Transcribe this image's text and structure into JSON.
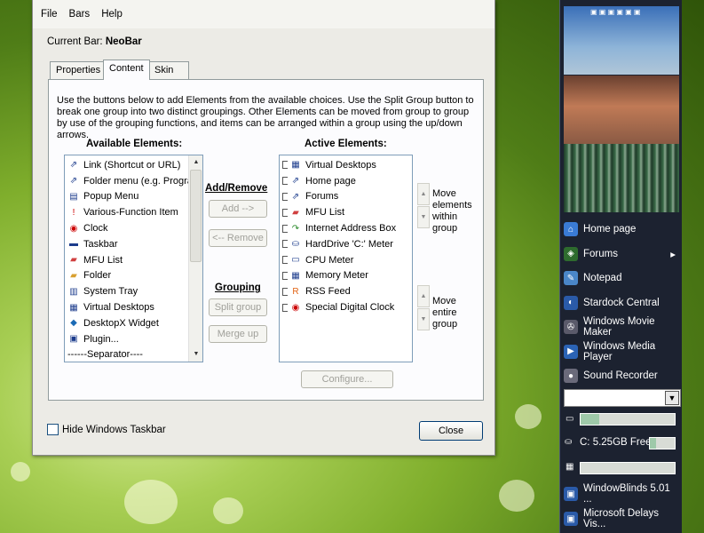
{
  "menu": {
    "file": "File",
    "bars": "Bars",
    "help": "Help"
  },
  "current_bar": {
    "label": "Current Bar:",
    "value": "NeoBar"
  },
  "tabs": [
    {
      "label": "Properties"
    },
    {
      "label": "Content"
    },
    {
      "label": "Skin"
    }
  ],
  "content": {
    "intro": "Use the buttons below to add Elements from the available choices. Use the Split Group button to break one group into two distinct groupings. Other Elements can be moved from group to group by use of the grouping functions, and items can be arranged within a group using the up/down arrows.",
    "available_header": "Available Elements:",
    "active_header": "Active Elements:",
    "available": [
      {
        "label": "Link (Shortcut or URL)",
        "icon": "link-icon"
      },
      {
        "label": "Folder menu (e.g. Program",
        "icon": "folder-menu-icon"
      },
      {
        "label": "Popup Menu",
        "icon": "popup-menu-icon"
      },
      {
        "label": "Various-Function Item",
        "icon": "exclamation-icon"
      },
      {
        "label": "Clock",
        "icon": "clock-icon"
      },
      {
        "label": "Taskbar",
        "icon": "taskbar-icon"
      },
      {
        "label": "MFU List",
        "icon": "mfu-folder-icon"
      },
      {
        "label": "Folder",
        "icon": "folder-icon"
      },
      {
        "label": "System Tray",
        "icon": "system-tray-icon"
      },
      {
        "label": "Virtual Desktops",
        "icon": "virtual-desktops-icon"
      },
      {
        "label": "DesktopX Widget",
        "icon": "desktopx-icon"
      },
      {
        "label": "Plugin...",
        "icon": "plugin-icon"
      },
      {
        "label": "------Separator----",
        "icon": ""
      }
    ],
    "active": [
      {
        "label": "Virtual Desktops",
        "icon": "virtual-desktops-icon"
      },
      {
        "label": "Home page",
        "icon": "link-icon"
      },
      {
        "label": "Forums",
        "icon": "link-icon"
      },
      {
        "label": "MFU List",
        "icon": "mfu-folder-icon"
      },
      {
        "label": "Internet Address Box",
        "icon": "internet-address-icon"
      },
      {
        "label": "HardDrive 'C:' Meter",
        "icon": "harddrive-icon"
      },
      {
        "label": "CPU Meter",
        "icon": "cpu-icon"
      },
      {
        "label": "Memory Meter",
        "icon": "memory-icon"
      },
      {
        "label": "RSS Feed",
        "icon": "rss-icon"
      },
      {
        "label": "Special Digital Clock",
        "icon": "clock-icon"
      }
    ],
    "add_remove_label": "Add/Remove",
    "add_button": "Add -->",
    "remove_button": "<-- Remove",
    "grouping_label": "Grouping",
    "split_button": "Split group",
    "merge_button": "Merge up",
    "move_within": "Move elements within group",
    "move_entire": "Move entire group",
    "configure_button": "Configure..."
  },
  "hide_taskbar": "Hide Windows Taskbar",
  "close_button": "Close",
  "bar": {
    "items": [
      {
        "label": "Home page",
        "icon": "home-icon",
        "color": "#3a7bd5"
      },
      {
        "label": "Forums",
        "icon": "forums-icon",
        "color": "#2e6b2e",
        "arrow": "▸"
      },
      {
        "label": "Notepad",
        "icon": "notepad-icon",
        "color": "#4a86c8"
      },
      {
        "label": "Stardock Central",
        "icon": "stardock-icon",
        "color": "#2a5aa8"
      },
      {
        "label": "Windows Movie Maker",
        "icon": "movie-maker-icon",
        "color": "#5a5a6a"
      },
      {
        "label": "Windows Media Player",
        "icon": "media-player-icon",
        "color": "#2b63b5"
      },
      {
        "label": "Sound Recorder",
        "icon": "sound-recorder-icon",
        "color": "#6a6a7a"
      }
    ],
    "drive_label": "C: 5.25GB Free",
    "cpu_level": 0.2,
    "drive_level": 0.25,
    "memory_level": 0.0,
    "tasks": [
      {
        "label": "WindowBlinds 5.01 ..."
      },
      {
        "label": "Microsoft Delays Vis..."
      }
    ]
  }
}
